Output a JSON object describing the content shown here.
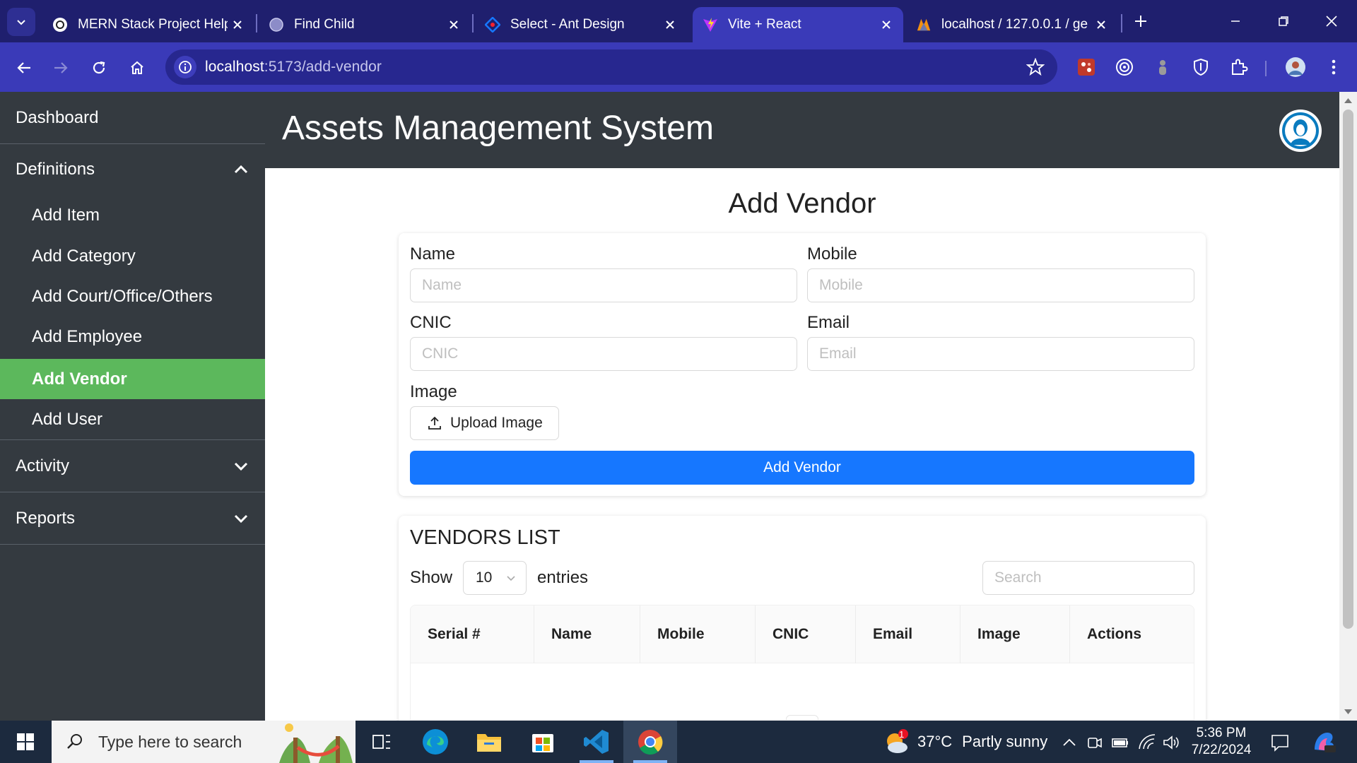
{
  "browser": {
    "tabs": [
      {
        "title": "MERN Stack Project Help"
      },
      {
        "title": "Find Child"
      },
      {
        "title": "Select - Ant Design"
      },
      {
        "title": "Vite + React"
      },
      {
        "title": "localhost / 127.0.0.1 / ge"
      }
    ],
    "url_host": "localhost",
    "url_path": ":5173/add-vendor"
  },
  "app": {
    "title": "Assets Management System",
    "sidebar": {
      "dashboard": "Dashboard",
      "definitions": "Definitions",
      "definition_items": [
        "Add Item",
        "Add Category",
        "Add Court/Office/Others",
        "Add Employee",
        "Add Vendor",
        "Add User"
      ],
      "activity": "Activity",
      "reports": "Reports"
    }
  },
  "form": {
    "heading": "Add Vendor",
    "name_label": "Name",
    "name_placeholder": "Name",
    "mobile_label": "Mobile",
    "mobile_placeholder": "Mobile",
    "cnic_label": "CNIC",
    "cnic_placeholder": "CNIC",
    "email_label": "Email",
    "email_placeholder": "Email",
    "image_label": "Image",
    "upload_label": "Upload Image",
    "submit_label": "Add Vendor"
  },
  "vendors_list": {
    "title": "VENDORS LIST",
    "show_label": "Show",
    "page_size": "10",
    "entries_label": "entries",
    "search_placeholder": "Search",
    "columns": [
      "Serial #",
      "Name",
      "Mobile",
      "CNIC",
      "Email",
      "Image",
      "Actions"
    ]
  },
  "taskbar": {
    "search_text": "Type here to search",
    "weather_temp": "37°C",
    "weather_desc": "Partly sunny",
    "weather_badge": "1",
    "time": "5:36 PM",
    "date": "7/22/2024"
  },
  "colors": {
    "sidebar_bg": "#343a40",
    "sidebar_active": "#5cb85c",
    "primary_button": "#1677ff",
    "browser_tabstrip": "#1f1f6e",
    "browser_toolbar": "#3a3ab8"
  }
}
